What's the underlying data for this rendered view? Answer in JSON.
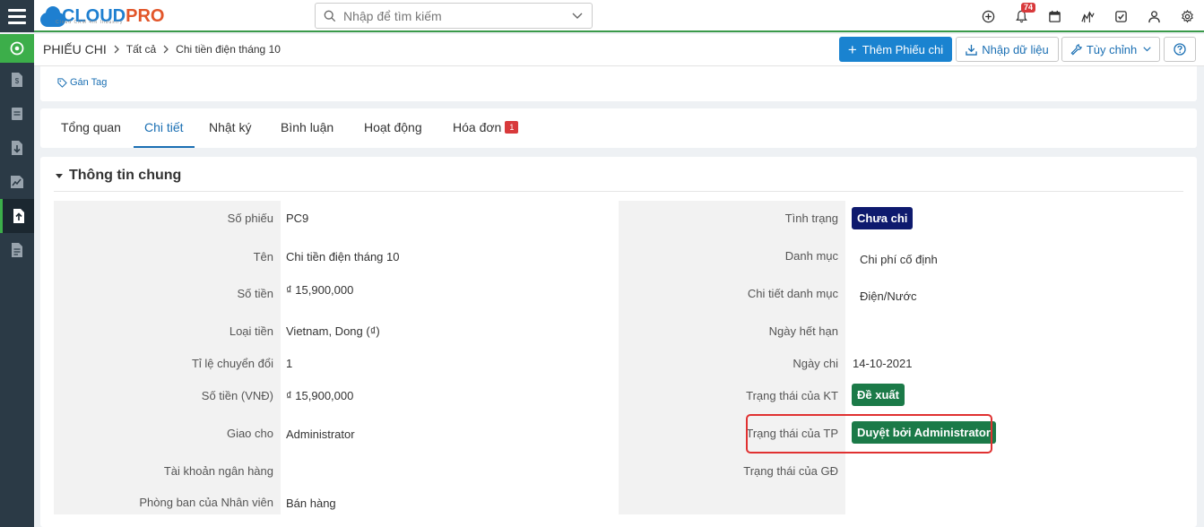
{
  "app": {
    "logo_cloud": "CLOUD",
    "logo_pro": "PRO",
    "logo_sub": "Cloud CRM 4th Industry",
    "search_placeholder": "Nhập để tìm kiếm",
    "notification_count": "74"
  },
  "breadcrumb": {
    "module": "PHIẾU CHI",
    "level1": "Tất cả",
    "level2": "Chi tiền điện tháng 10"
  },
  "actions": {
    "add_label": "Thêm Phiếu chi",
    "import_label": "Nhập dữ liệu",
    "customize_label": "Tùy chỉnh"
  },
  "tag": {
    "label": "Gán Tag"
  },
  "tabs": [
    {
      "label": "Tổng quan"
    },
    {
      "label": "Chi tiết"
    },
    {
      "label": "Nhật ký"
    },
    {
      "label": "Bình luận"
    },
    {
      "label": "Hoạt động"
    },
    {
      "label": "Hóa đơn",
      "badge": "1"
    }
  ],
  "section": {
    "title": "Thông tin chung"
  },
  "left_fields": [
    {
      "label": "Số phiếu",
      "value": "PC9"
    },
    {
      "label": "Tên",
      "value": "Chi tiền điện tháng 10"
    },
    {
      "label": "Số tiền",
      "value": "₫ 15,900,000"
    },
    {
      "label": "Loại tiền",
      "value": "Vietnam, Dong (₫)"
    },
    {
      "label": "Tỉ lệ chuyển đổi",
      "value": "1"
    },
    {
      "label": "Số tiền (VNĐ)",
      "value": "₫ 15,900,000"
    },
    {
      "label": "Giao cho",
      "value": "Administrator"
    },
    {
      "label": "Tài khoản ngân hàng",
      "value": ""
    },
    {
      "label": "Phòng ban của Nhân viên",
      "value": "Bán hàng"
    }
  ],
  "right_fields": [
    {
      "label": "Tình trạng",
      "value": "Chưa chi"
    },
    {
      "label": "Danh mục",
      "value": "Chi phí cố định"
    },
    {
      "label": "Chi tiết danh mục",
      "value": "Điện/Nước"
    },
    {
      "label": "Ngày hết hạn",
      "value": ""
    },
    {
      "label": "Ngày chi",
      "value": "14-10-2021"
    },
    {
      "label": "Trạng thái của KT",
      "value": "Đề xuất"
    },
    {
      "label": "Trạng thái của TP",
      "value": "Duyệt bởi Administrator"
    },
    {
      "label": "Trạng thái của GĐ",
      "value": ""
    }
  ],
  "colors": {
    "accent": "#1a83d0",
    "status_navy": "#0e1a6e",
    "status_green": "#1b7a48",
    "highlight": "#e03131"
  }
}
